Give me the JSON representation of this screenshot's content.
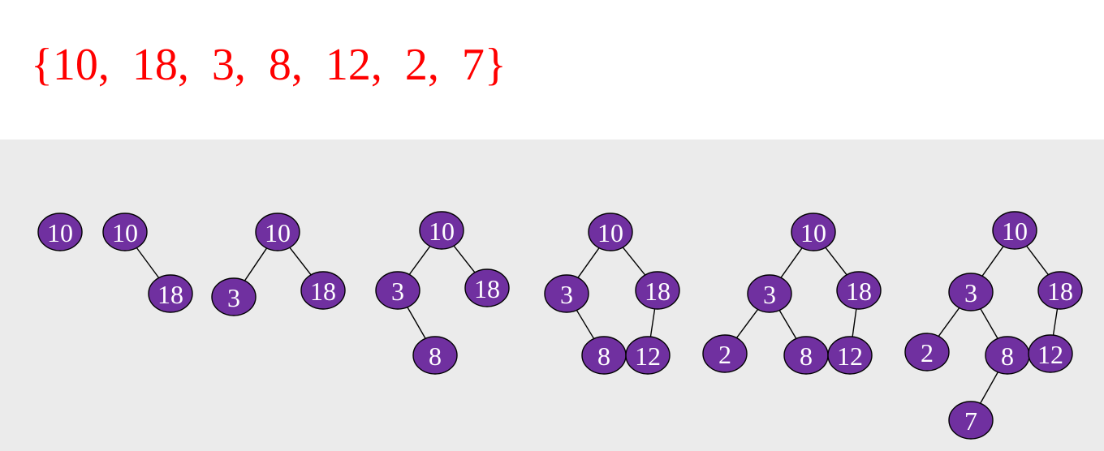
{
  "sequence_text": "{10,  18,  3,  8,  12,  2,  7}",
  "colors": {
    "sequence": "#ff0000",
    "node_fill": "#7030a0",
    "node_text": "#ffffff",
    "panel_background": "#ebebeb",
    "edge": "#000000"
  },
  "insertion_steps": [
    {
      "step": 1,
      "nodes": [
        {
          "id": "n10",
          "label": "10"
        }
      ],
      "edges": []
    },
    {
      "step": 2,
      "nodes": [
        {
          "id": "n10",
          "label": "10"
        },
        {
          "id": "n18",
          "label": "18"
        }
      ],
      "edges": [
        [
          "n10",
          "n18"
        ]
      ]
    },
    {
      "step": 3,
      "nodes": [
        {
          "id": "n10",
          "label": "10"
        },
        {
          "id": "n3",
          "label": "3"
        },
        {
          "id": "n18",
          "label": "18"
        }
      ],
      "edges": [
        [
          "n10",
          "n3"
        ],
        [
          "n10",
          "n18"
        ]
      ]
    },
    {
      "step": 4,
      "nodes": [
        {
          "id": "n10",
          "label": "10"
        },
        {
          "id": "n3",
          "label": "3"
        },
        {
          "id": "n18",
          "label": "18"
        },
        {
          "id": "n8",
          "label": "8"
        }
      ],
      "edges": [
        [
          "n10",
          "n3"
        ],
        [
          "n10",
          "n18"
        ],
        [
          "n3",
          "n8"
        ]
      ]
    },
    {
      "step": 5,
      "nodes": [
        {
          "id": "n10",
          "label": "10"
        },
        {
          "id": "n3",
          "label": "3"
        },
        {
          "id": "n18",
          "label": "18"
        },
        {
          "id": "n8",
          "label": "8"
        },
        {
          "id": "n12",
          "label": "12"
        }
      ],
      "edges": [
        [
          "n10",
          "n3"
        ],
        [
          "n10",
          "n18"
        ],
        [
          "n3",
          "n8"
        ],
        [
          "n18",
          "n12"
        ]
      ]
    },
    {
      "step": 6,
      "nodes": [
        {
          "id": "n10",
          "label": "10"
        },
        {
          "id": "n3",
          "label": "3"
        },
        {
          "id": "n18",
          "label": "18"
        },
        {
          "id": "n2",
          "label": "2"
        },
        {
          "id": "n8",
          "label": "8"
        },
        {
          "id": "n12",
          "label": "12"
        }
      ],
      "edges": [
        [
          "n10",
          "n3"
        ],
        [
          "n10",
          "n18"
        ],
        [
          "n3",
          "n2"
        ],
        [
          "n3",
          "n8"
        ],
        [
          "n18",
          "n12"
        ]
      ]
    },
    {
      "step": 7,
      "nodes": [
        {
          "id": "n10",
          "label": "10"
        },
        {
          "id": "n3",
          "label": "3"
        },
        {
          "id": "n18",
          "label": "18"
        },
        {
          "id": "n2",
          "label": "2"
        },
        {
          "id": "n8",
          "label": "8"
        },
        {
          "id": "n12",
          "label": "12"
        },
        {
          "id": "n7",
          "label": "7"
        }
      ],
      "edges": [
        [
          "n10",
          "n3"
        ],
        [
          "n10",
          "n18"
        ],
        [
          "n3",
          "n2"
        ],
        [
          "n3",
          "n8"
        ],
        [
          "n18",
          "n12"
        ],
        [
          "n8",
          "n7"
        ]
      ]
    }
  ]
}
